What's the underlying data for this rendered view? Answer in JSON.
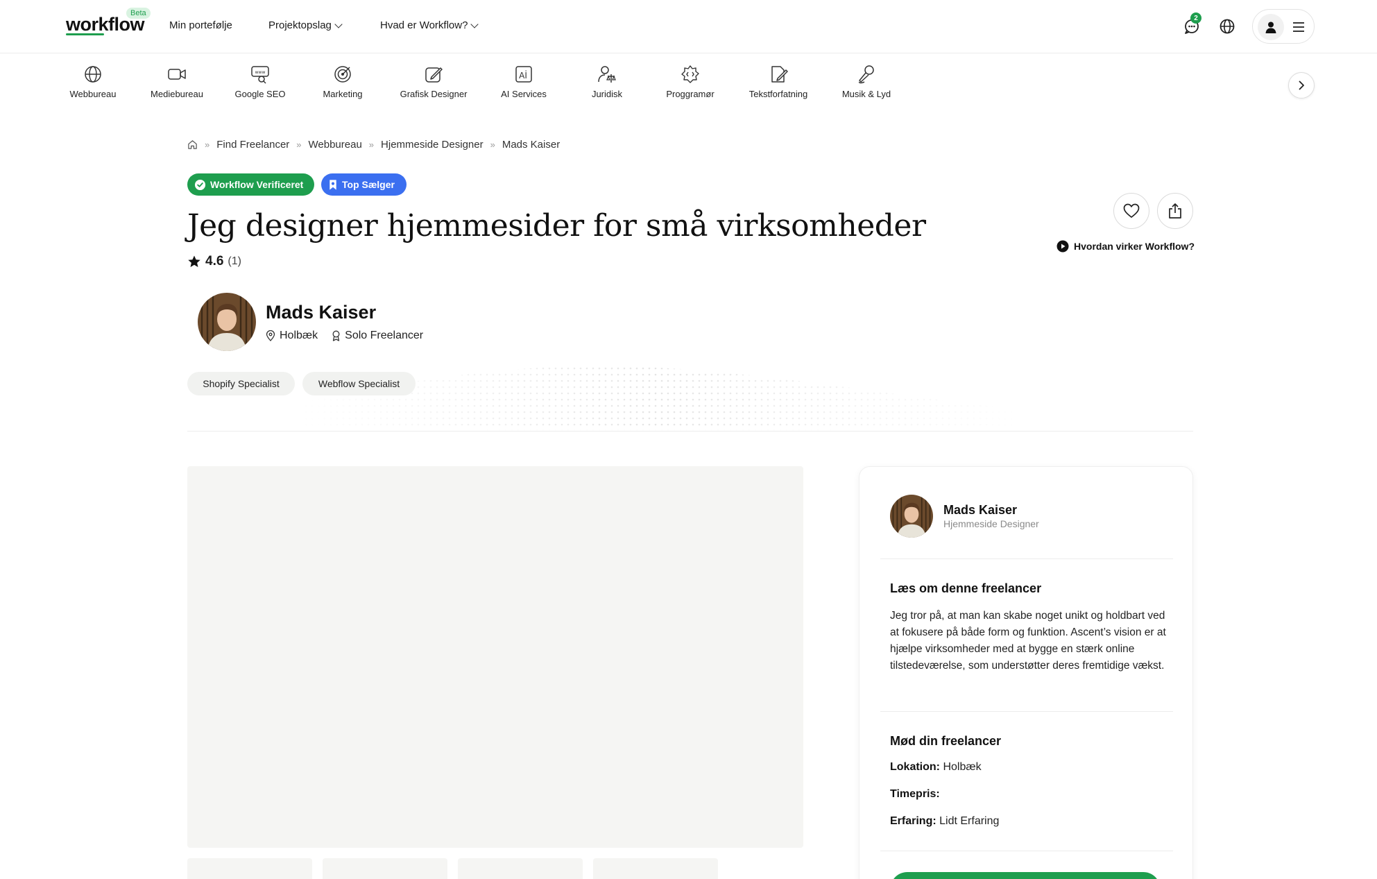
{
  "header": {
    "logo": "workflow",
    "beta": "Beta",
    "nav": [
      {
        "label": "Min portefølje"
      },
      {
        "label": "Projektopslag"
      },
      {
        "label": "Hvad er Workflow?"
      }
    ],
    "notification_count": "2"
  },
  "categories": [
    {
      "label": "Webbureau",
      "icon": "globe-icon"
    },
    {
      "label": "Mediebureau",
      "icon": "video-camera-icon"
    },
    {
      "label": "Google SEO",
      "icon": "www-search-icon"
    },
    {
      "label": "Marketing",
      "icon": "target-icon"
    },
    {
      "label": "Grafisk Designer",
      "icon": "design-pen-icon"
    },
    {
      "label": "AI Services",
      "icon": "ai-icon"
    },
    {
      "label": "Juridisk",
      "icon": "legal-scale-icon"
    },
    {
      "label": "Proggramør",
      "icon": "code-gear-icon"
    },
    {
      "label": "Tekstforfatning",
      "icon": "document-pen-icon"
    },
    {
      "label": "Musik & Lyd",
      "icon": "microphone-icon"
    }
  ],
  "breadcrumb": [
    "Find Freelancer",
    "Webbureau",
    "Hjemmeside Designer",
    "Mads Kaiser"
  ],
  "badges": {
    "verified": "Workflow Verificeret",
    "top_seller": "Top Sælger"
  },
  "listing": {
    "title": "Jeg designer hjemmesider for små virksomheder",
    "rating": "4.6",
    "rating_count": "(1)",
    "how_it_works": "Hvordan virker Workflow?"
  },
  "freelancer": {
    "name": "Mads Kaiser",
    "location": "Holbæk",
    "type": "Solo Freelancer",
    "skills": [
      "Shopify Specialist",
      "Webflow Specialist"
    ]
  },
  "sidebar": {
    "name": "Mads Kaiser",
    "role": "Hjemmeside Designer",
    "about_heading": "Læs om denne freelancer",
    "about_text": "Jeg tror på, at man kan skabe noget unikt og holdbart ved at fokusere på både form og funktion. Ascent’s vision er at hjælpe virksomheder med at bygge en stærk online tilstedeværelse, som understøtter deres fremtidige vækst.",
    "meet_heading": "Mød din freelancer",
    "location_label": "Lokation:",
    "location_value": "Holbæk",
    "rate_label": "Timepris:",
    "rate_value": "",
    "experience_label": "Erfaring:",
    "experience_value": "Lidt Erfaring"
  },
  "colors": {
    "brand_green": "#1e9e4e",
    "badge_blue": "#3b6ff0"
  }
}
